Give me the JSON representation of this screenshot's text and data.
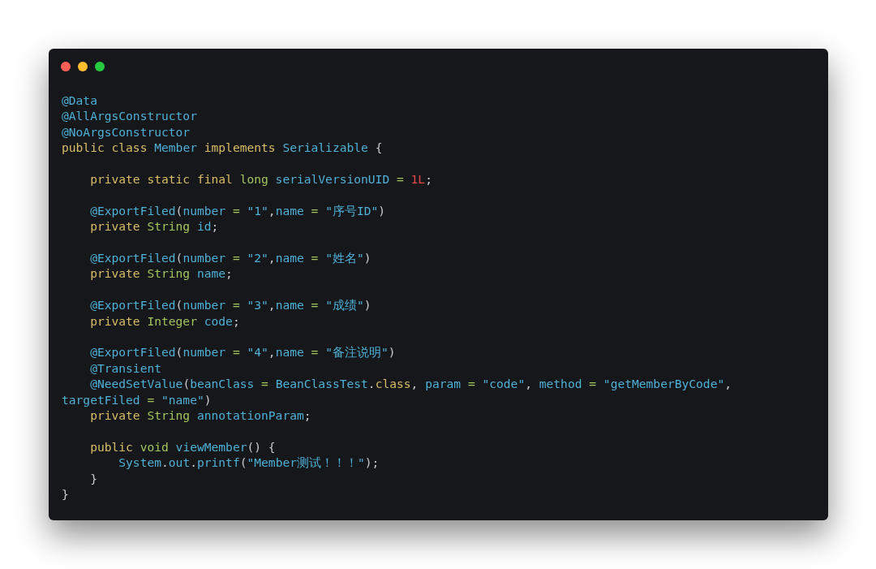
{
  "window": {
    "controls": [
      {
        "kind": "close"
      },
      {
        "kind": "minimize"
      },
      {
        "kind": "maximize"
      }
    ]
  },
  "code_blocks": [
    {
      "lines": [
        {
          "tokens": [
            {
              "text": "@Data",
              "kind": "ann"
            }
          ]
        },
        {
          "tokens": [
            {
              "text": "@AllArgsConstructor",
              "kind": "ann"
            }
          ]
        },
        {
          "tokens": [
            {
              "text": "@NoArgsConstructor",
              "kind": "ann"
            }
          ]
        },
        {
          "tokens": [
            {
              "text": "public class ",
              "kind": "kw"
            },
            {
              "text": "Member ",
              "kind": "id"
            },
            {
              "text": "implements ",
              "kind": "kw"
            },
            {
              "text": "Serializable ",
              "kind": "id"
            },
            {
              "text": "{",
              "kind": "punc"
            }
          ]
        }
      ]
    },
    {
      "lines": [
        {
          "tokens": [
            {
              "text": "    private static final ",
              "kind": "kw"
            },
            {
              "text": "long ",
              "kind": "type"
            },
            {
              "text": "serialVersionUID ",
              "kind": "id"
            },
            {
              "text": "= ",
              "kind": "op"
            },
            {
              "text": "1L",
              "kind": "num"
            },
            {
              "text": ";",
              "kind": "punc"
            }
          ]
        }
      ]
    },
    {
      "lines": [
        {
          "tokens": [
            {
              "text": "    @ExportFiled",
              "kind": "ann"
            },
            {
              "text": "(",
              "kind": "punc"
            },
            {
              "text": "number ",
              "kind": "id"
            },
            {
              "text": "= ",
              "kind": "op"
            },
            {
              "text": "\"1\"",
              "kind": "str"
            },
            {
              "text": ",",
              "kind": "punc"
            },
            {
              "text": "name ",
              "kind": "id"
            },
            {
              "text": "= ",
              "kind": "op"
            },
            {
              "text": "\"序号ID\"",
              "kind": "str"
            },
            {
              "text": ")",
              "kind": "punc"
            }
          ]
        },
        {
          "tokens": [
            {
              "text": "    private ",
              "kind": "kw"
            },
            {
              "text": "String ",
              "kind": "type"
            },
            {
              "text": "id",
              "kind": "id"
            },
            {
              "text": ";",
              "kind": "punc"
            }
          ]
        }
      ]
    },
    {
      "lines": [
        {
          "tokens": [
            {
              "text": "    @ExportFiled",
              "kind": "ann"
            },
            {
              "text": "(",
              "kind": "punc"
            },
            {
              "text": "number ",
              "kind": "id"
            },
            {
              "text": "= ",
              "kind": "op"
            },
            {
              "text": "\"2\"",
              "kind": "str"
            },
            {
              "text": ",",
              "kind": "punc"
            },
            {
              "text": "name ",
              "kind": "id"
            },
            {
              "text": "= ",
              "kind": "op"
            },
            {
              "text": "\"姓名\"",
              "kind": "str"
            },
            {
              "text": ")",
              "kind": "punc"
            }
          ]
        },
        {
          "tokens": [
            {
              "text": "    private ",
              "kind": "kw"
            },
            {
              "text": "String ",
              "kind": "type"
            },
            {
              "text": "name",
              "kind": "id"
            },
            {
              "text": ";",
              "kind": "punc"
            }
          ]
        }
      ]
    },
    {
      "lines": [
        {
          "tokens": [
            {
              "text": "    @ExportFiled",
              "kind": "ann"
            },
            {
              "text": "(",
              "kind": "punc"
            },
            {
              "text": "number ",
              "kind": "id"
            },
            {
              "text": "= ",
              "kind": "op"
            },
            {
              "text": "\"3\"",
              "kind": "str"
            },
            {
              "text": ",",
              "kind": "punc"
            },
            {
              "text": "name ",
              "kind": "id"
            },
            {
              "text": "= ",
              "kind": "op"
            },
            {
              "text": "\"成绩\"",
              "kind": "str"
            },
            {
              "text": ")",
              "kind": "punc"
            }
          ]
        },
        {
          "tokens": [
            {
              "text": "    private ",
              "kind": "kw"
            },
            {
              "text": "Integer ",
              "kind": "type"
            },
            {
              "text": "code",
              "kind": "id"
            },
            {
              "text": ";",
              "kind": "punc"
            }
          ]
        }
      ]
    },
    {
      "lines": [
        {
          "tokens": [
            {
              "text": "    @ExportFiled",
              "kind": "ann"
            },
            {
              "text": "(",
              "kind": "punc"
            },
            {
              "text": "number ",
              "kind": "id"
            },
            {
              "text": "= ",
              "kind": "op"
            },
            {
              "text": "\"4\"",
              "kind": "str"
            },
            {
              "text": ",",
              "kind": "punc"
            },
            {
              "text": "name ",
              "kind": "id"
            },
            {
              "text": "= ",
              "kind": "op"
            },
            {
              "text": "\"备注说明\"",
              "kind": "str"
            },
            {
              "text": ")",
              "kind": "punc"
            }
          ]
        },
        {
          "tokens": [
            {
              "text": "    @Transient",
              "kind": "ann"
            }
          ]
        },
        {
          "tokens": [
            {
              "text": "    @NeedSetValue",
              "kind": "ann"
            },
            {
              "text": "(",
              "kind": "punc"
            },
            {
              "text": "beanClass ",
              "kind": "id"
            },
            {
              "text": "= ",
              "kind": "op"
            },
            {
              "text": "BeanClassTest",
              "kind": "id"
            },
            {
              "text": ".",
              "kind": "punc"
            },
            {
              "text": "class",
              "kind": "kw"
            },
            {
              "text": ", ",
              "kind": "punc"
            },
            {
              "text": "param ",
              "kind": "id"
            },
            {
              "text": "= ",
              "kind": "op"
            },
            {
              "text": "\"code\"",
              "kind": "str"
            },
            {
              "text": ", ",
              "kind": "punc"
            },
            {
              "text": "method ",
              "kind": "id"
            },
            {
              "text": "= ",
              "kind": "op"
            },
            {
              "text": "\"getMemberByCode\"",
              "kind": "str"
            },
            {
              "text": ",",
              "kind": "punc"
            }
          ]
        },
        {
          "tokens": [
            {
              "text": "targetFiled ",
              "kind": "id"
            },
            {
              "text": "= ",
              "kind": "op"
            },
            {
              "text": "\"name\"",
              "kind": "str"
            },
            {
              "text": ")",
              "kind": "punc"
            }
          ]
        },
        {
          "tokens": [
            {
              "text": "    private ",
              "kind": "kw"
            },
            {
              "text": "String ",
              "kind": "type"
            },
            {
              "text": "annotationParam",
              "kind": "id"
            },
            {
              "text": ";",
              "kind": "punc"
            }
          ]
        }
      ]
    },
    {
      "lines": [
        {
          "tokens": [
            {
              "text": "    public ",
              "kind": "kw"
            },
            {
              "text": "void ",
              "kind": "type"
            },
            {
              "text": "viewMember",
              "kind": "id"
            },
            {
              "text": "() {",
              "kind": "punc"
            }
          ]
        },
        {
          "tokens": [
            {
              "text": "        System",
              "kind": "id"
            },
            {
              "text": ".",
              "kind": "punc"
            },
            {
              "text": "out",
              "kind": "id"
            },
            {
              "text": ".",
              "kind": "punc"
            },
            {
              "text": "printf",
              "kind": "id"
            },
            {
              "text": "(",
              "kind": "punc"
            },
            {
              "text": "\"Member测试！！！\"",
              "kind": "str"
            },
            {
              "text": ");",
              "kind": "punc"
            }
          ]
        },
        {
          "tokens": [
            {
              "text": "    }",
              "kind": "punc"
            }
          ]
        },
        {
          "tokens": [
            {
              "text": "}",
              "kind": "punc"
            }
          ]
        }
      ]
    }
  ]
}
